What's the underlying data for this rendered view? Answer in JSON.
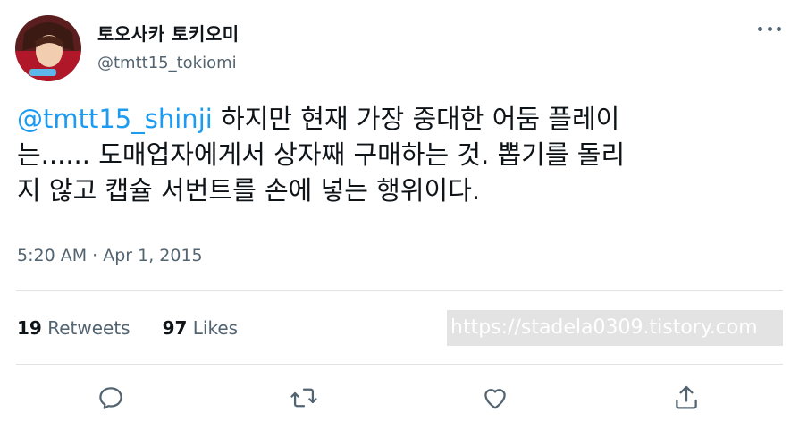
{
  "user": {
    "display_name": "토오사카 토키오미",
    "handle": "@tmtt15_tokiomi",
    "avatar_icon": "avatar-image"
  },
  "tweet": {
    "mention": "@tmtt15_shinji",
    "line1_rest": " 하지만 현재 가장 중대한 어둠 플레이",
    "line2": "는...... 도매업자에게서 상자째 구매하는 것. 뽑기를 돌리",
    "line3": "지 않고 캡슐 서번트를 손에 넣는 행위이다.",
    "timestamp": "5:20 AM · Apr 1, 2015"
  },
  "stats": {
    "retweets_count": "19",
    "retweets_label": "Retweets",
    "likes_count": "97",
    "likes_label": "Likes"
  },
  "watermark": "https://stadela0309.tistory.com",
  "actions": {
    "reply_icon": "reply-icon",
    "retweet_icon": "retweet-icon",
    "like_icon": "heart-icon",
    "share_icon": "share-icon"
  },
  "colors": {
    "accent": "#1d9bf0",
    "text": "#0f1419",
    "secondary": "#536471",
    "divider": "#dfe3e6"
  }
}
